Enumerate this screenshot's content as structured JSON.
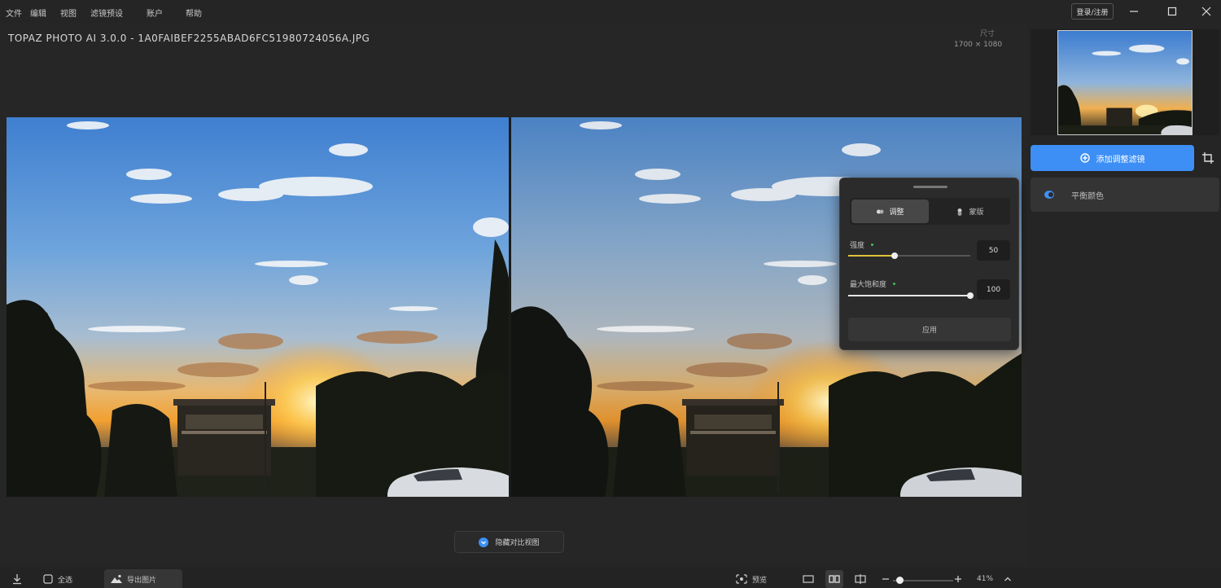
{
  "menu": {
    "items": [
      "文件",
      "编辑",
      "视图",
      "滤镜预设",
      "账户",
      "帮助"
    ],
    "sign_in_label": "登录/注册"
  },
  "document": {
    "title": "TOPAZ PHOTO AI 3.0.0 - 1A0FAIBEF2255ABAD6FC51980724056A.JPG",
    "dimensions": "1700 × 1080",
    "dimensions_label": "尺寸"
  },
  "panel": {
    "tabs": [
      {
        "label": "调整",
        "icon": "sliders-icon",
        "active": true
      },
      {
        "label": "蒙版",
        "icon": "mask-icon",
        "active": false
      }
    ],
    "sliders": [
      {
        "label": "强度",
        "value": "50",
        "fraction": 0.38
      },
      {
        "label": "最大饱和度",
        "value": "100",
        "fraction": 1.0
      }
    ],
    "apply_label": "应用"
  },
  "sidebar": {
    "primary_button": "添加调整滤镜",
    "secondary_button": "平衡颜色"
  },
  "compare_button": "隐藏对比视图",
  "statusbar": {
    "select_all": "全选",
    "image_chip": "导出图片",
    "preview_label": "预览",
    "zoom": "41%",
    "zoom_fraction": 0.05
  },
  "colors": {
    "accent": "#3d8ff5",
    "slider_fill": "#e1c23b",
    "background": "#252525"
  }
}
